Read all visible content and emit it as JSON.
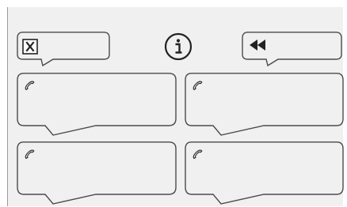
{
  "controls": {
    "close_button_icon": "close-x-icon",
    "info_button_icon": "info-circle-icon",
    "rewind_button_icon": "double-left-arrow-icon"
  },
  "phone_cards": [
    {
      "icon": "phone-handset-icon"
    },
    {
      "icon": "phone-handset-icon"
    },
    {
      "icon": "phone-handset-icon"
    },
    {
      "icon": "phone-handset-icon"
    }
  ],
  "colors": {
    "background": "#f0f0f0",
    "stroke": "#4a4a4a",
    "icon": "#222222"
  }
}
